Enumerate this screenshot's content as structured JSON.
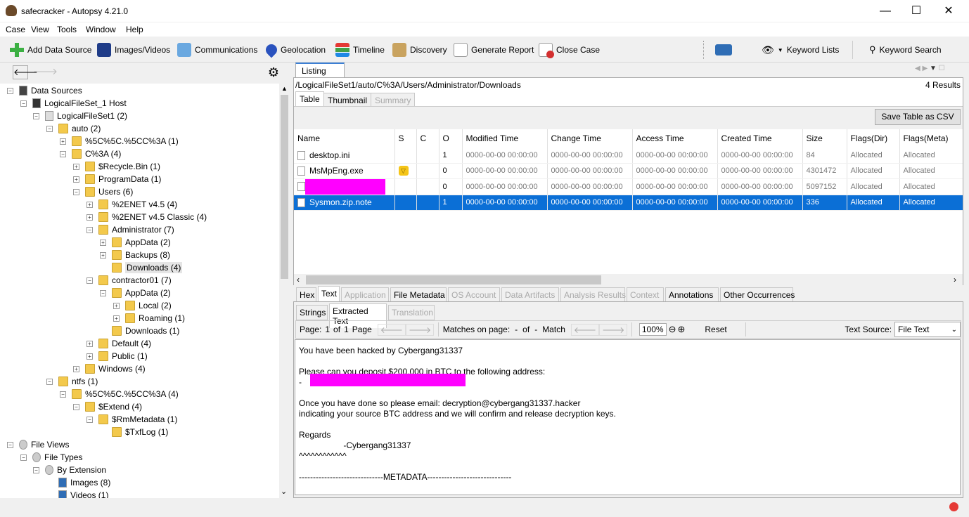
{
  "window": {
    "title": "safecracker - Autopsy 4.21.0"
  },
  "menu": [
    "Case",
    "View",
    "Tools",
    "Window",
    "Help"
  ],
  "toolbar": {
    "add_data_source": "Add Data Source",
    "images_videos": "Images/Videos",
    "communications": "Communications",
    "geolocation": "Geolocation",
    "timeline": "Timeline",
    "discovery": "Discovery",
    "generate_report": "Generate Report",
    "close_case": "Close Case",
    "keyword_lists": "Keyword Lists",
    "keyword_search": "Keyword Search"
  },
  "tree": [
    {
      "label": "Data Sources",
      "depth": 0,
      "type": "root",
      "toggle": "-"
    },
    {
      "label": "LogicalFileSet_1 Host",
      "depth": 1,
      "type": "host",
      "toggle": "-"
    },
    {
      "label": "LogicalFileSet1 (2)",
      "depth": 2,
      "type": "set",
      "toggle": "-"
    },
    {
      "label": "auto (2)",
      "depth": 3,
      "type": "folder",
      "toggle": "-"
    },
    {
      "label": "%5C%5C.%5CC%3A (1)",
      "depth": 4,
      "type": "folder",
      "toggle": "+"
    },
    {
      "label": "C%3A (4)",
      "depth": 4,
      "type": "folder",
      "toggle": "-"
    },
    {
      "label": "$Recycle.Bin (1)",
      "depth": 5,
      "type": "folder",
      "toggle": "+"
    },
    {
      "label": "ProgramData (1)",
      "depth": 5,
      "type": "folder",
      "toggle": "+"
    },
    {
      "label": "Users (6)",
      "depth": 5,
      "type": "folder",
      "toggle": "-"
    },
    {
      "label": "%2ENET v4.5 (4)",
      "depth": 6,
      "type": "folder",
      "toggle": "+"
    },
    {
      "label": "%2ENET v4.5 Classic (4)",
      "depth": 6,
      "type": "folder",
      "toggle": "+"
    },
    {
      "label": "Administrator (7)",
      "depth": 6,
      "type": "folder",
      "toggle": "-"
    },
    {
      "label": "AppData (2)",
      "depth": 7,
      "type": "folder",
      "toggle": "+"
    },
    {
      "label": "Backups (8)",
      "depth": 7,
      "type": "folder",
      "toggle": "+"
    },
    {
      "label": "Downloads (4)",
      "depth": 7,
      "type": "folder",
      "toggle": "",
      "selected": true
    },
    {
      "label": "contractor01 (7)",
      "depth": 6,
      "type": "folder",
      "toggle": "-"
    },
    {
      "label": "AppData (2)",
      "depth": 7,
      "type": "folder",
      "toggle": "-"
    },
    {
      "label": "Local (2)",
      "depth": 8,
      "type": "folder",
      "toggle": "+"
    },
    {
      "label": "Roaming (1)",
      "depth": 8,
      "type": "folder",
      "toggle": "+"
    },
    {
      "label": "Downloads (1)",
      "depth": 7,
      "type": "folder",
      "toggle": ""
    },
    {
      "label": "Default (4)",
      "depth": 6,
      "type": "folder",
      "toggle": "+"
    },
    {
      "label": "Public (1)",
      "depth": 6,
      "type": "folder",
      "toggle": "+"
    },
    {
      "label": "Windows (4)",
      "depth": 5,
      "type": "folder",
      "toggle": "+"
    },
    {
      "label": "ntfs (1)",
      "depth": 3,
      "type": "folder",
      "toggle": "-"
    },
    {
      "label": "%5C%5C.%5CC%3A (4)",
      "depth": 4,
      "type": "folder",
      "toggle": "-"
    },
    {
      "label": "$Extend (4)",
      "depth": 5,
      "type": "folder",
      "toggle": "-"
    },
    {
      "label": "$RmMetadata (1)",
      "depth": 6,
      "type": "folder",
      "toggle": "-"
    },
    {
      "label": "$TxfLog (1)",
      "depth": 7,
      "type": "folder",
      "toggle": ""
    },
    {
      "label": "File Views",
      "depth": 0,
      "type": "views",
      "toggle": "-"
    },
    {
      "label": "File Types",
      "depth": 1,
      "type": "views",
      "toggle": "-"
    },
    {
      "label": "By Extension",
      "depth": 2,
      "type": "views",
      "toggle": "-"
    },
    {
      "label": "Images (8)",
      "depth": 3,
      "type": "file",
      "toggle": ""
    },
    {
      "label": "Videos (1)",
      "depth": 3,
      "type": "file",
      "toggle": ""
    }
  ],
  "listing": {
    "tab": "Listing",
    "path": "/LogicalFileSet1/auto/C%3A/Users/Administrator/Downloads",
    "results": "4  Results",
    "subtabs": [
      "Table",
      "Thumbnail",
      "Summary"
    ],
    "save_csv": "Save Table as CSV",
    "columns": [
      "Name",
      "S",
      "C",
      "O",
      "Modified Time",
      "Change Time",
      "Access Time",
      "Created Time",
      "Size",
      "Flags(Dir)",
      "Flags(Meta)"
    ],
    "rows": [
      {
        "name": "desktop.ini",
        "s": "",
        "c": "",
        "o": "1",
        "mod": "0000-00-00 00:00:00",
        "chg": "0000-00-00 00:00:00",
        "acc": "0000-00-00 00:00:00",
        "cre": "0000-00-00 00:00:00",
        "size": "84",
        "fdir": "Allocated",
        "fmeta": "Allocated"
      },
      {
        "name": "MsMpEng.exe",
        "s": "▽",
        "c": "",
        "o": "0",
        "mod": "0000-00-00 00:00:00",
        "chg": "0000-00-00 00:00:00",
        "acc": "0000-00-00 00:00:00",
        "cre": "0000-00-00 00:00:00",
        "size": "4301472",
        "fdir": "Allocated",
        "fmeta": "Allocated"
      },
      {
        "name": "",
        "redacted": true,
        "s": "",
        "c": "",
        "o": "0",
        "mod": "0000-00-00 00:00:00",
        "chg": "0000-00-00 00:00:00",
        "acc": "0000-00-00 00:00:00",
        "cre": "0000-00-00 00:00:00",
        "size": "5097152",
        "fdir": "Allocated",
        "fmeta": "Allocated"
      },
      {
        "name": "Sysmon.zip.note",
        "s": "",
        "c": "",
        "o": "1",
        "mod": "0000-00-00 00:00:00",
        "chg": "0000-00-00 00:00:00",
        "acc": "0000-00-00 00:00:00",
        "cre": "0000-00-00 00:00:00",
        "size": "336",
        "fdir": "Allocated",
        "fmeta": "Allocated",
        "selected": true
      }
    ]
  },
  "content_tabs": [
    "Hex",
    "Text",
    "Application",
    "File Metadata",
    "OS Account",
    "Data Artifacts",
    "Analysis Results",
    "Context",
    "Annotations",
    "Other Occurrences"
  ],
  "text_tabs": [
    "Strings",
    "Extracted Text",
    "Translation"
  ],
  "viewer": {
    "page_label": "Page:",
    "page_num": "1",
    "of_label": "of",
    "page_total": "1",
    "page_word": "Page",
    "matches_label": "Matches on page:",
    "matches_val": "-",
    "matches_total": "-",
    "match_word": "Match",
    "zoom": "100%",
    "reset": "Reset",
    "text_source_label": "Text Source:",
    "text_source": "File Text"
  },
  "extracted_text": [
    "You have been hacked by Cybergang31337",
    "",
    "Please can you deposit $200,000 in BTC to the following address:",
    "-",
    "",
    "Once you have done so please email: decryption@cybergang31337.hacker",
    "indicating your source BTC address and we will confirm and release decryption keys.",
    "",
    "Regards",
    "                   -Cybergang31337",
    "^^^^^^^^^^^^",
    "",
    "------------------------------METADATA------------------------------"
  ],
  "colors": {
    "accent": "#0b6fd6",
    "redaction": "#ff00ff",
    "folder": "#f3c94c"
  }
}
